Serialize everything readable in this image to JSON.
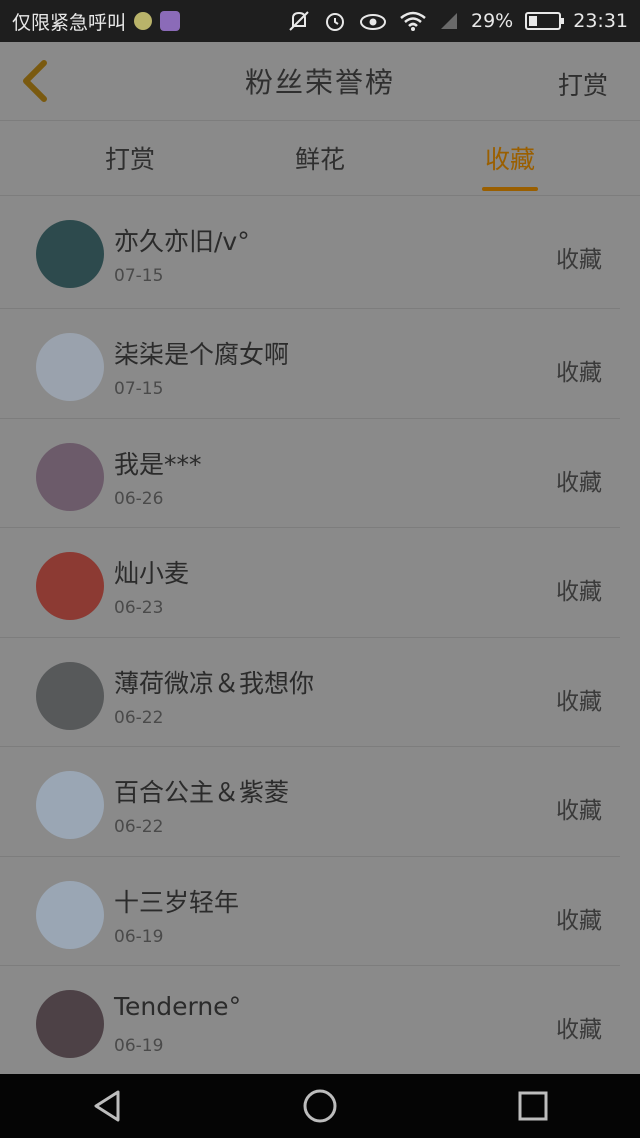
{
  "status_bar": {
    "carrier": "仅限紧急呼叫",
    "battery_percent": "29%",
    "battery_level": 0.29,
    "time": "23:31",
    "icons": [
      "emoji-icon",
      "gallery-icon",
      "mute-icon",
      "alarm-icon",
      "eye-icon",
      "wifi-icon",
      "signal-icon",
      "battery-icon"
    ]
  },
  "header": {
    "title": "粉丝荣誉榜",
    "right_action": "打赏"
  },
  "tabs": [
    {
      "label": "打赏",
      "active": false
    },
    {
      "label": "鲜花",
      "active": false
    },
    {
      "label": "收藏",
      "active": true
    }
  ],
  "rows": [
    {
      "name": "亦久亦旧/v°",
      "date": "07-15",
      "action": "收藏",
      "avatar_color": "#2d4a4d"
    },
    {
      "name": "柒柒是个腐女啊",
      "date": "07-15",
      "action": "收藏",
      "avatar_color": "#9aa2ad"
    },
    {
      "name": "我是***",
      "date": "06-26",
      "action": "收藏",
      "avatar_color": "#6c5b6a"
    },
    {
      "name": "灿小麦",
      "date": "06-23",
      "action": "收藏",
      "avatar_color": "#8c3a33"
    },
    {
      "name": "薄荷微凉＆我想你",
      "date": "06-22",
      "action": "收藏",
      "avatar_color": "#57595a"
    },
    {
      "name": "百合公主＆紫菱",
      "date": "06-22",
      "action": "收藏",
      "avatar_color": "#9aa6b4"
    },
    {
      "name": "十三岁轻年",
      "date": "06-19",
      "action": "收藏",
      "avatar_color": "#9aa6b4"
    },
    {
      "name": "Tenderne°",
      "date": "06-19",
      "action": "收藏",
      "avatar_color": "#4d4146"
    }
  ],
  "bottom_nav": {
    "icons": [
      "back-triangle-icon",
      "home-circle-icon",
      "recents-square-icon"
    ]
  }
}
